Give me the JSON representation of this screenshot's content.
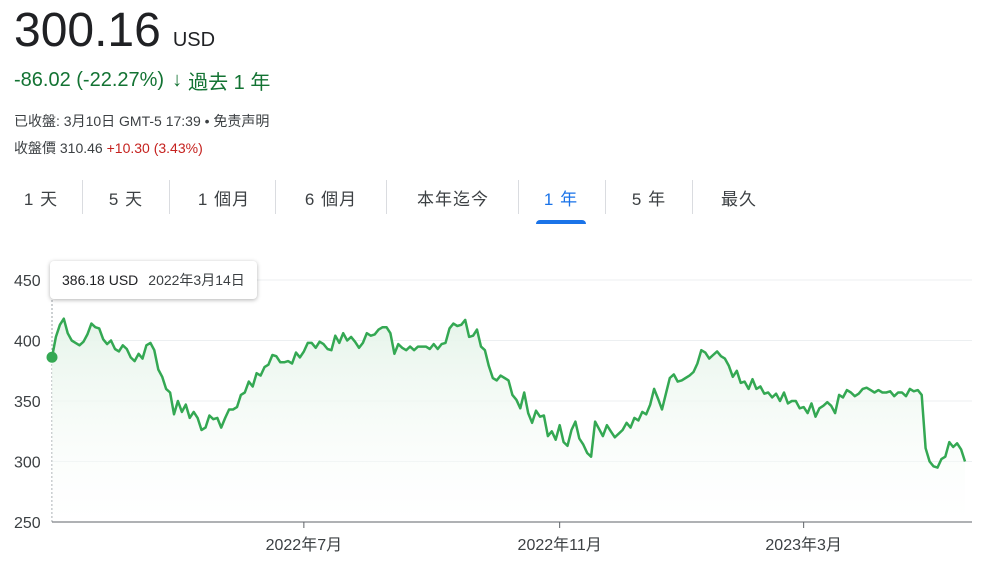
{
  "quote": {
    "price": "300.16",
    "currency": "USD",
    "change": "-86.02 (-22.27%)",
    "change_arrow": "↓",
    "change_period": "過去 1 年",
    "close_info": "已收盤: 3月10日 GMT-5 17:39 • 免责声明",
    "close_price_label": "收盤價 310.46",
    "close_price_change": "+10.30 (3.43%)"
  },
  "tabs": [
    {
      "label": "1 天"
    },
    {
      "label": "5 天"
    },
    {
      "label": "1 個月"
    },
    {
      "label": "6 個月"
    },
    {
      "label": "本年迄今"
    },
    {
      "label": "1 年",
      "active": true
    },
    {
      "label": "5 年"
    },
    {
      "label": "最久"
    }
  ],
  "tooltip": {
    "value": "386.18 USD",
    "date": "2022年3月14日"
  },
  "colors": {
    "line": "#34a853",
    "area_top": "#e6f4ea",
    "positive_change": "#137333",
    "negative_close": "#c5221f",
    "active_tab": "#1a73e8"
  },
  "chart_data": {
    "type": "area",
    "y_ticks": [
      "450",
      "400",
      "350",
      "300",
      "250"
    ],
    "y_tick_values": [
      450,
      400,
      350,
      300,
      250
    ],
    "ylim": [
      250,
      450
    ],
    "x_ticks": [
      "2022年7月",
      "2022年11月",
      "2023年3月"
    ],
    "x_tick_indices": [
      64,
      129,
      191
    ],
    "values": [
      386,
      403,
      413,
      418,
      406,
      400,
      398,
      396,
      399,
      405,
      414,
      411,
      410,
      401,
      397,
      400,
      393,
      391,
      396,
      393,
      386,
      383,
      389,
      385,
      396,
      398,
      392,
      376,
      370,
      360,
      357,
      339,
      350,
      341,
      347,
      336,
      341,
      336,
      326,
      328,
      338,
      335,
      336,
      328,
      336,
      343,
      343,
      345,
      355,
      357,
      366,
      362,
      373,
      371,
      378,
      380,
      388,
      387,
      382,
      382,
      383,
      381,
      390,
      386,
      391,
      398,
      398,
      394,
      399,
      397,
      393,
      392,
      404,
      398,
      406,
      400,
      403,
      399,
      394,
      398,
      406,
      404,
      405,
      409,
      411,
      411,
      406,
      389,
      397,
      394,
      392,
      395,
      392,
      395,
      395,
      395,
      393,
      397,
      393,
      397,
      398,
      410,
      414,
      412,
      413,
      417,
      403,
      404,
      409,
      395,
      392,
      379,
      369,
      367,
      371,
      369,
      367,
      355,
      351,
      344,
      357,
      340,
      332,
      342,
      337,
      338,
      321,
      325,
      318,
      330,
      316,
      313,
      326,
      333,
      319,
      314,
      307,
      304,
      333,
      327,
      321,
      330,
      325,
      320,
      323,
      326,
      332,
      328,
      336,
      334,
      341,
      339,
      347,
      360,
      352,
      343,
      356,
      369,
      372,
      366,
      367,
      369,
      371,
      374,
      381,
      392,
      390,
      385,
      388,
      391,
      387,
      385,
      379,
      370,
      375,
      365,
      366,
      360,
      368,
      360,
      362,
      356,
      357,
      353,
      356,
      350,
      357,
      348,
      350,
      350,
      344,
      345,
      340,
      348,
      337,
      344,
      346,
      349,
      346,
      340,
      355,
      353,
      359,
      357,
      354,
      356,
      360,
      361,
      359,
      357,
      359,
      357,
      357,
      358,
      354,
      357,
      357,
      354,
      360,
      358,
      359,
      355,
      311,
      300,
      296,
      295,
      302,
      304,
      316,
      312,
      315,
      310,
      300
    ],
    "first_point": {
      "value": 386.18,
      "date": "2022年3月14日"
    },
    "grid": true
  }
}
